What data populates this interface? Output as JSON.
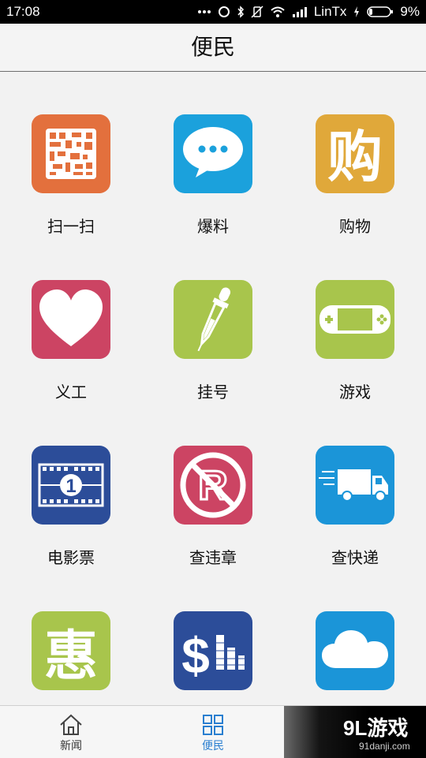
{
  "status_bar": {
    "time": "17:08",
    "carrier": "LinTx",
    "battery": "9%",
    "icons": [
      "dots-icon",
      "sync-icon",
      "bluetooth-icon",
      "vibrate-icon",
      "wifi-icon",
      "signal-icon",
      "charging-icon",
      "battery-icon"
    ]
  },
  "header": {
    "title": "便民"
  },
  "grid": {
    "items": [
      {
        "label": "扫一扫",
        "icon": "qr-code-icon",
        "color": "#e3703d"
      },
      {
        "label": "爆料",
        "icon": "chat-bubble-icon",
        "color": "#1ba1dc"
      },
      {
        "label": "购物",
        "icon": "shop-char-icon",
        "color": "#e0a83a"
      },
      {
        "label": "义工",
        "icon": "heart-icon",
        "color": "#cc4463"
      },
      {
        "label": "挂号",
        "icon": "dropper-icon",
        "color": "#a8c54c"
      },
      {
        "label": "游戏",
        "icon": "gamepad-icon",
        "color": "#a8c54c"
      },
      {
        "label": "电影票",
        "icon": "film-icon",
        "color": "#2c4d99"
      },
      {
        "label": "查违章",
        "icon": "no-parking-icon",
        "color": "#cc4463"
      },
      {
        "label": "查快递",
        "icon": "truck-icon",
        "color": "#1b95d8"
      },
      {
        "label": "",
        "icon": "discount-char-icon",
        "color": "#a8c54c"
      },
      {
        "label": "",
        "icon": "money-chart-icon",
        "color": "#2c4d99"
      },
      {
        "label": "",
        "icon": "cloud-icon",
        "color": "#1b95d8"
      }
    ],
    "qr_char": "",
    "shop_char": "购",
    "discount_char": "惠",
    "film_number": "1",
    "parking_letter": "R",
    "money_symbol": "$"
  },
  "tabbar": {
    "tabs": [
      {
        "label": "新闻",
        "icon": "home-icon",
        "active": false
      },
      {
        "label": "便民",
        "icon": "grid-icon",
        "active": true
      }
    ],
    "active_color": "#2a7fd0"
  },
  "watermark": {
    "logo": "9L游戏",
    "url": "91danji.com"
  }
}
